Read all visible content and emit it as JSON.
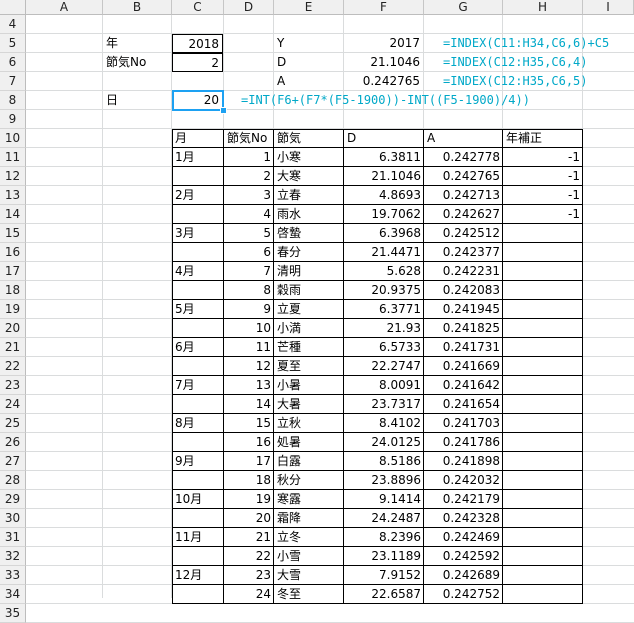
{
  "columns": [
    "A",
    "B",
    "C",
    "D",
    "E",
    "F",
    "G",
    "H",
    "I"
  ],
  "rows": [
    4,
    5,
    6,
    7,
    8,
    9,
    10,
    11,
    12,
    13,
    14,
    15,
    16,
    17,
    18,
    19,
    20,
    21,
    22,
    23,
    24,
    25,
    26,
    27,
    28,
    29,
    30,
    31,
    32,
    33,
    34,
    35
  ],
  "inputs": {
    "year_label": "年",
    "year_value": "2018",
    "sekki_label": "節気No",
    "sekki_value": "2",
    "day_label": "日",
    "day_value": "20"
  },
  "lookup": {
    "y_label": "Y",
    "y_value": "2017",
    "y_formula": "=INDEX(C11:H34,C6,6)+C5",
    "d_label": "D",
    "d_value": "21.1046",
    "d_formula": "=INDEX(C12:H35,C6,4)",
    "a_label": "A",
    "a_value": "0.242765",
    "a_formula": "=INDEX(C12:H35,C6,5)",
    "day_formula": "=INT(F6+(F7*(F5-1900))-INT((F5-1900)/4))"
  },
  "table": {
    "headers": [
      "月",
      "節気No",
      "節気",
      "D",
      "A",
      "年補正"
    ],
    "rows": [
      [
        "1月",
        "1",
        "小寒",
        "6.3811",
        "0.242778",
        "-1"
      ],
      [
        "",
        "2",
        "大寒",
        "21.1046",
        "0.242765",
        "-1"
      ],
      [
        "2月",
        "3",
        "立春",
        "4.8693",
        "0.242713",
        "-1"
      ],
      [
        "",
        "4",
        "雨水",
        "19.7062",
        "0.242627",
        "-1"
      ],
      [
        "3月",
        "5",
        "啓蟄",
        "6.3968",
        "0.242512",
        ""
      ],
      [
        "",
        "6",
        "春分",
        "21.4471",
        "0.242377",
        ""
      ],
      [
        "4月",
        "7",
        "清明",
        "5.628",
        "0.242231",
        ""
      ],
      [
        "",
        "8",
        "穀雨",
        "20.9375",
        "0.242083",
        ""
      ],
      [
        "5月",
        "9",
        "立夏",
        "6.3771",
        "0.241945",
        ""
      ],
      [
        "",
        "10",
        "小満",
        "21.93",
        "0.241825",
        ""
      ],
      [
        "6月",
        "11",
        "芒種",
        "6.5733",
        "0.241731",
        ""
      ],
      [
        "",
        "12",
        "夏至",
        "22.2747",
        "0.241669",
        ""
      ],
      [
        "7月",
        "13",
        "小暑",
        "8.0091",
        "0.241642",
        ""
      ],
      [
        "",
        "14",
        "大暑",
        "23.7317",
        "0.241654",
        ""
      ],
      [
        "8月",
        "15",
        "立秋",
        "8.4102",
        "0.241703",
        ""
      ],
      [
        "",
        "16",
        "処暑",
        "24.0125",
        "0.241786",
        ""
      ],
      [
        "9月",
        "17",
        "白露",
        "8.5186",
        "0.241898",
        ""
      ],
      [
        "",
        "18",
        "秋分",
        "23.8896",
        "0.242032",
        ""
      ],
      [
        "10月",
        "19",
        "寒露",
        "9.1414",
        "0.242179",
        ""
      ],
      [
        "",
        "20",
        "霜降",
        "24.2487",
        "0.242328",
        ""
      ],
      [
        "11月",
        "21",
        "立冬",
        "8.2396",
        "0.242469",
        ""
      ],
      [
        "",
        "22",
        "小雪",
        "23.1189",
        "0.242592",
        ""
      ],
      [
        "12月",
        "23",
        "大雪",
        "7.9152",
        "0.242689",
        ""
      ],
      [
        "",
        "24",
        "冬至",
        "22.6587",
        "0.242752",
        ""
      ]
    ]
  }
}
